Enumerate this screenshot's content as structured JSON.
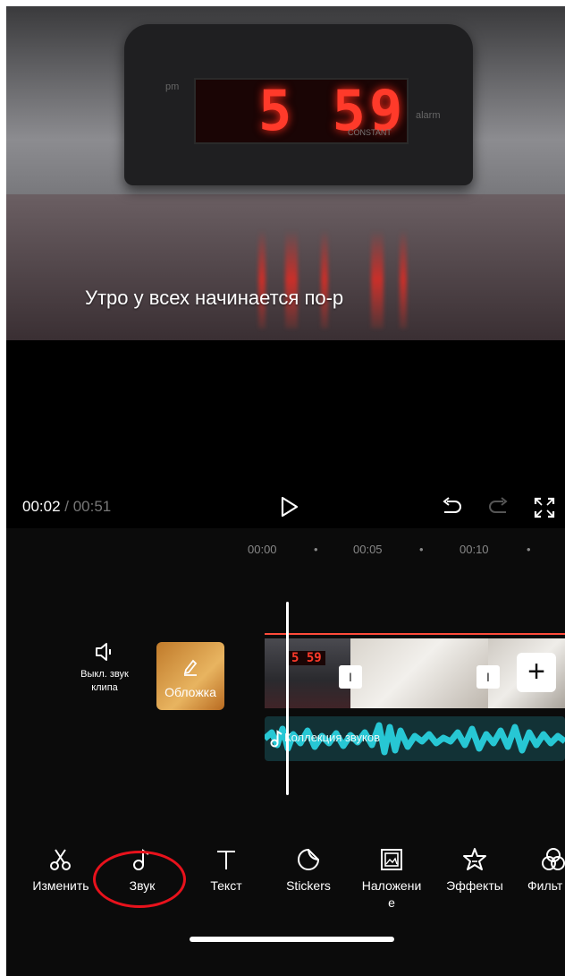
{
  "preview": {
    "clock_digits": "5 59",
    "clock_pm": "pm",
    "clock_alarm": "alarm",
    "clock_brand": "CONSTANT",
    "subtitle": "Утро у всех начинается по-р"
  },
  "controls": {
    "current_time": "00:02",
    "separator": " / ",
    "duration": "00:51"
  },
  "timeline": {
    "ruler": [
      "00:00",
      "00:05",
      "00:10"
    ],
    "mute_label_line1": "Выкл. звук",
    "mute_label_line2": "клипа",
    "cover_label": "Обложка",
    "clip_thumb_digits": "5 59",
    "audio_track_label": "Коллекция звуков"
  },
  "toolbar": [
    {
      "label": "Изменить",
      "icon": "scissors-icon"
    },
    {
      "label": "Звук",
      "icon": "music-note-icon"
    },
    {
      "label": "Текст",
      "icon": "text-icon"
    },
    {
      "label": "Stickers",
      "icon": "sticker-icon"
    },
    {
      "label": "Наложени е",
      "icon": "overlay-icon"
    },
    {
      "label": "Эффекты",
      "icon": "effects-star-icon"
    },
    {
      "label": "Фильт",
      "icon": "filter-icon"
    }
  ],
  "colors": {
    "accent_red": "#ff4b3a",
    "audio_teal": "#27c7d4",
    "highlight_circle": "#e8121c"
  }
}
